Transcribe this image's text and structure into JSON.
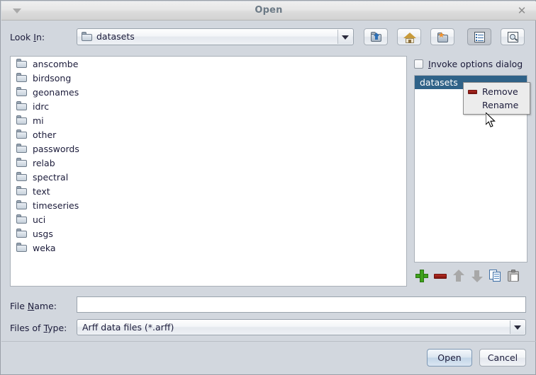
{
  "window": {
    "title": "Open",
    "menu_icon": "triangle-down-icon",
    "close_icon": "close-icon"
  },
  "lookin": {
    "label_pre": "Look ",
    "label_mnemonic": "I",
    "label_post": "n:",
    "value": "datasets",
    "folder_icon": "folder-icon",
    "dropdown_icon": "chevron-down-icon"
  },
  "toolbar": {
    "buttons": [
      {
        "name": "up-one-level-button",
        "icon": "up-folder-icon",
        "pressed": false
      },
      {
        "name": "home-button",
        "icon": "home-icon",
        "pressed": false
      },
      {
        "name": "create-new-folder-button",
        "icon": "new-folder-icon",
        "pressed": false
      },
      {
        "name": "list-view-button",
        "icon": "list-view-icon",
        "pressed": true
      },
      {
        "name": "details-view-button",
        "icon": "details-view-icon",
        "pressed": false
      }
    ]
  },
  "file_list": {
    "items": [
      "anscombe",
      "birdsong",
      "geonames",
      "idrc",
      "mi",
      "other",
      "passwords",
      "relab",
      "spectral",
      "text",
      "timeseries",
      "uci",
      "usgs",
      "weka"
    ]
  },
  "right_panel": {
    "checkbox": {
      "label_pre": "",
      "label_mnemonic": "I",
      "label_post": "nvoke options dialog",
      "checked": false
    },
    "directory_list": {
      "selected": "datasets"
    },
    "tools": [
      {
        "name": "add-button",
        "icon": "plus-icon"
      },
      {
        "name": "remove-button",
        "icon": "minus-icon"
      },
      {
        "name": "move-up-button",
        "icon": "arrow-up-icon"
      },
      {
        "name": "move-down-button",
        "icon": "arrow-down-icon"
      },
      {
        "name": "copy-button",
        "icon": "copy-icon"
      },
      {
        "name": "paste-button",
        "icon": "paste-icon"
      }
    ]
  },
  "context_menu": {
    "items": [
      {
        "label": "Remove",
        "icon": "minus-icon"
      },
      {
        "label": "Rename",
        "icon": ""
      }
    ]
  },
  "form": {
    "file_name": {
      "label_pre": "File ",
      "label_mnemonic": "N",
      "label_post": "ame:",
      "value": "",
      "placeholder": ""
    },
    "files_of_type": {
      "label_pre": "Files of ",
      "label_mnemonic": "T",
      "label_post": "ype:",
      "value": "Arff data files (*.arff)",
      "dropdown_icon": "chevron-down-icon"
    }
  },
  "footer": {
    "open_label": "Open",
    "cancel_label": "Cancel"
  },
  "colors": {
    "background": "#d2d7de",
    "selection": "#2f6288",
    "title_text": "#6c7a86",
    "accent_green": "#3fa21c",
    "accent_red": "#b02a22"
  }
}
